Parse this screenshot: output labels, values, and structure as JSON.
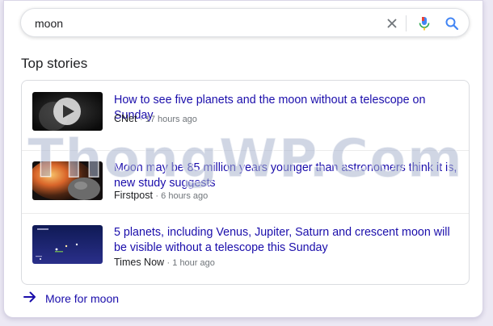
{
  "search": {
    "query": "moon",
    "clear_icon": "close-icon",
    "mic_icon": "mic-icon",
    "search_icon": "search-icon"
  },
  "top_stories": {
    "title": "Top stories",
    "stories": [
      {
        "headline": "How to see five planets and the moon without a telescope on Sunday",
        "source": "CNet",
        "time": "17 hours ago",
        "thumbnail": "video-play-thumbnail"
      },
      {
        "headline": "Moon may be 85 million years younger than astronomers think it is, new study suggests",
        "source": "Firstpost",
        "time": "6 hours ago",
        "thumbnail": "moon-impact-thumbnail"
      },
      {
        "headline": "5 planets, including Venus, Jupiter, Saturn and crescent moon will be visible without a telescope this Sunday",
        "source": "Times Now",
        "time": "1 hour ago",
        "thumbnail": "sky-chart-thumbnail"
      }
    ]
  },
  "more": {
    "label": "More for moon",
    "icon": "arrow-right-icon"
  },
  "watermark": "ThongWP.Com",
  "colors": {
    "link": "#1a0dab",
    "meta": "#70757a",
    "mic_blue": "#4285f4",
    "mic_red": "#ea4335"
  }
}
